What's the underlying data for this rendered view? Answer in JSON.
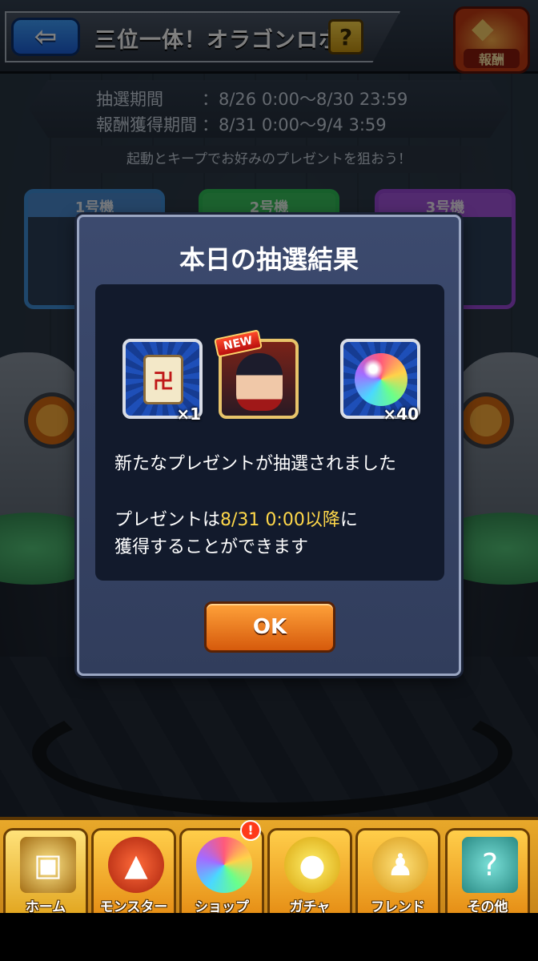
{
  "header": {
    "back_glyph": "⇦",
    "title": "三位一体！オラゴンロボ",
    "help_glyph": "?",
    "reward_label": "報酬"
  },
  "period": {
    "draw_label": "抽選期間",
    "draw_value": "：8/26 0:00〜8/30 23:59",
    "reward_label": "報酬獲得期間",
    "reward_value": "：8/31 0:00〜9/4 3:59",
    "hint": "起動とキープでお好みのプレゼントを狙おう！"
  },
  "machines": [
    "1号機",
    "2号機",
    "3号機"
  ],
  "modal": {
    "title": "本日の抽選結果",
    "items": [
      {
        "icon": "scroll-icon",
        "qty": "×1"
      },
      {
        "icon": "character-icon",
        "tag": "NEW"
      },
      {
        "icon": "orb-icon",
        "qty": "×40"
      }
    ],
    "message1": "新たなプレゼントが抽選されました",
    "message2_prefix": "プレゼントは",
    "message2_highlight": "8/31 0:00以降",
    "message2_suffix": "に",
    "message3": "獲得することができます",
    "ok_label": "OK"
  },
  "nav": [
    {
      "label": "ホーム",
      "icon": "home-icon"
    },
    {
      "label": "モンスター",
      "icon": "monster-icon"
    },
    {
      "label": "ショップ",
      "icon": "shop-icon"
    },
    {
      "label": "ガチャ",
      "icon": "gacha-icon"
    },
    {
      "label": "フレンド",
      "icon": "friend-icon"
    },
    {
      "label": "その他",
      "icon": "other-icon"
    }
  ],
  "nav_alert": "!",
  "colors": {
    "highlight": "#ffd84a",
    "ok_button": "#f07a1a",
    "back_button": "#2a7ef0",
    "nav_bar": "#e8a82a"
  }
}
